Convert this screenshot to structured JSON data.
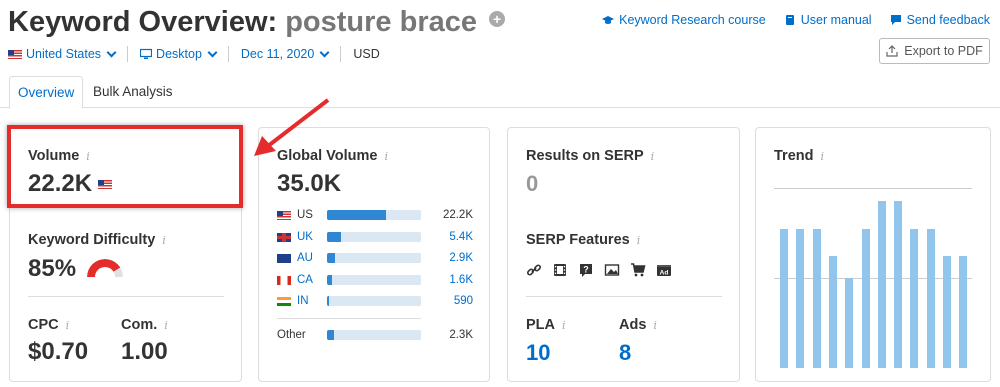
{
  "header": {
    "title": "Keyword Overview:",
    "keyword": "posture brace",
    "add_icon": "plus-circle-icon",
    "links": [
      {
        "label": "Keyword Research course",
        "icon": "graduation-cap-icon"
      },
      {
        "label": "User manual",
        "icon": "book-icon"
      },
      {
        "label": "Send feedback",
        "icon": "speech-bubble-icon"
      }
    ],
    "export_label": "Export to PDF"
  },
  "filters": {
    "country": "United States",
    "device": "Desktop",
    "date": "Dec 11, 2020",
    "currency": "USD"
  },
  "tabs": [
    {
      "label": "Overview",
      "active": true
    },
    {
      "label": "Bulk Analysis",
      "active": false
    }
  ],
  "volume": {
    "label": "Volume",
    "value": "22.2K"
  },
  "keyword_difficulty": {
    "label": "Keyword Difficulty",
    "value": "85%",
    "level": 0.85,
    "color": "#e52c2c"
  },
  "cpc": {
    "label": "CPC",
    "value": "$0.70"
  },
  "competition": {
    "label": "Com.",
    "value": "1.00"
  },
  "global_volume": {
    "label": "Global Volume",
    "value": "35.0K",
    "countries": [
      {
        "code": "US",
        "value": "22.2K",
        "share": 0.63
      },
      {
        "code": "UK",
        "value": "5.4K",
        "share": 0.15
      },
      {
        "code": "AU",
        "value": "2.9K",
        "share": 0.08
      },
      {
        "code": "CA",
        "value": "1.6K",
        "share": 0.05
      },
      {
        "code": "IN",
        "value": "590",
        "share": 0.02
      }
    ],
    "other": {
      "label": "Other",
      "value": "2.3K",
      "share": 0.07
    }
  },
  "results_on_serp": {
    "label": "Results on SERP",
    "value": "0"
  },
  "serp_features": {
    "label": "SERP Features",
    "icons": [
      "link-icon",
      "film-icon",
      "question-icon",
      "image-icon",
      "shopping-cart-icon",
      "ad-icon"
    ]
  },
  "pla": {
    "label": "PLA",
    "value": "10"
  },
  "ads": {
    "label": "Ads",
    "value": "8"
  },
  "trend": {
    "label": "Trend",
    "values": [
      0.77,
      0.77,
      0.77,
      0.62,
      0.5,
      0.77,
      0.93,
      0.93,
      0.77,
      0.77,
      0.62,
      0.62
    ],
    "bar_color": "#92c5ec"
  },
  "accent_color": "#006dca"
}
